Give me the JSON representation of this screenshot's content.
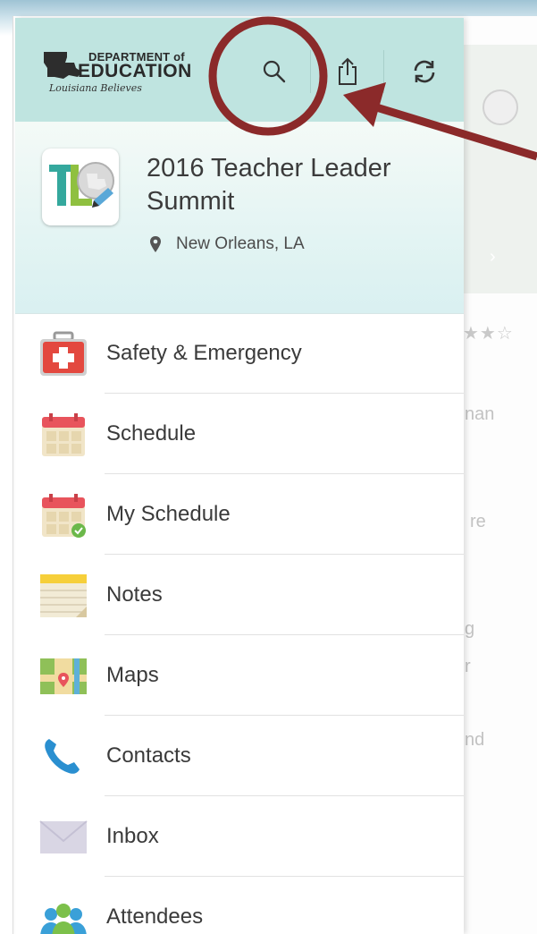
{
  "background": {
    "text_fragments": [
      "nan",
      "re",
      "g",
      "r",
      "nd"
    ],
    "stars": "★★☆"
  },
  "toolbar": {
    "logo": {
      "line1": "DEPARTMENT of",
      "line2": "EDUCATION",
      "line3": "Louisiana Believes"
    },
    "buttons": [
      {
        "icon": "search-icon"
      },
      {
        "icon": "share-icon"
      },
      {
        "icon": "refresh-icon"
      }
    ]
  },
  "event": {
    "title": "2016 Teacher Leader Summit",
    "location": "New Orleans, LA"
  },
  "menu": {
    "items": [
      {
        "label": "Safety & Emergency",
        "icon": "first-aid-kit-icon"
      },
      {
        "label": "Schedule",
        "icon": "calendar-icon"
      },
      {
        "label": "My Schedule",
        "icon": "calendar-check-icon"
      },
      {
        "label": "Notes",
        "icon": "notepad-icon"
      },
      {
        "label": "Maps",
        "icon": "map-icon"
      },
      {
        "label": "Contacts",
        "icon": "phone-icon"
      },
      {
        "label": "Inbox",
        "icon": "envelope-icon"
      },
      {
        "label": "Attendees",
        "icon": "people-icon"
      }
    ]
  },
  "colors": {
    "toolbar_bg": "#bfe4e0",
    "annotation": "#8b2a2a"
  }
}
